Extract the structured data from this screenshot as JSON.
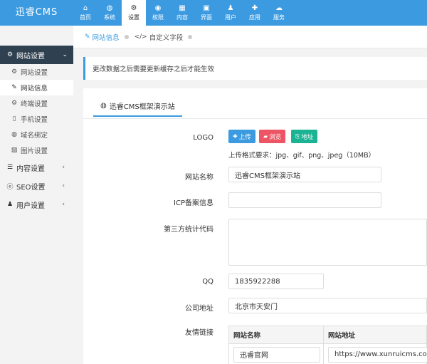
{
  "app": {
    "logo": "迅睿CMS"
  },
  "nav": [
    {
      "label": "首页",
      "icon": "home-icon",
      "glyph": "⌂",
      "active": false
    },
    {
      "label": "系统",
      "icon": "globe-icon",
      "glyph": "◍",
      "active": false
    },
    {
      "label": "设置",
      "icon": "cogs-icon",
      "glyph": "⚙",
      "active": true
    },
    {
      "label": "权限",
      "icon": "user-circle-icon",
      "glyph": "◉",
      "active": false
    },
    {
      "label": "内容",
      "icon": "grid-icon",
      "glyph": "▦",
      "active": false
    },
    {
      "label": "界面",
      "icon": "html5-icon",
      "glyph": "▣",
      "active": false
    },
    {
      "label": "用户",
      "icon": "user-icon",
      "glyph": "♟",
      "active": false
    },
    {
      "label": "应用",
      "icon": "puzzle-icon",
      "glyph": "✚",
      "active": false
    },
    {
      "label": "服务",
      "icon": "cloud-icon",
      "glyph": "☁",
      "active": false
    }
  ],
  "sidebar": {
    "active_group": {
      "label": "网站设置",
      "icon": "gear-icon",
      "glyph": "⚙"
    },
    "sub_items": [
      {
        "label": "网站设置",
        "icon": "gear-icon",
        "glyph": "⚙",
        "active": false
      },
      {
        "label": "网站信息",
        "icon": "edit-icon",
        "glyph": "✎",
        "active": true
      },
      {
        "label": "终端设置",
        "icon": "cogs-icon",
        "glyph": "⚙",
        "active": false
      },
      {
        "label": "手机设置",
        "icon": "mobile-icon",
        "glyph": "▯",
        "active": false
      },
      {
        "label": "域名绑定",
        "icon": "globe-icon",
        "glyph": "◍",
        "active": false
      },
      {
        "label": "图片设置",
        "icon": "image-icon",
        "glyph": "▨",
        "active": false
      }
    ],
    "groups": [
      {
        "label": "内容设置",
        "icon": "bars-icon",
        "glyph": "☰"
      },
      {
        "label": "SEO设置",
        "icon": "ie-icon",
        "glyph": "ⓔ"
      },
      {
        "label": "用户设置",
        "icon": "user-icon",
        "glyph": "♟"
      }
    ]
  },
  "tabs": [
    {
      "label": "网站信息",
      "icon": "edit-icon",
      "glyph": "✎",
      "active": true
    },
    {
      "label": "自定义字段",
      "icon": "code-icon",
      "glyph": "</>",
      "active": false
    }
  ],
  "notice": "更改数据之后需要更新缓存之后才能生效",
  "panel": {
    "tab_label": "迅睿CMS框架演示站",
    "tab_icon": "globe-icon",
    "tab_glyph": "◍"
  },
  "form": {
    "logo_label": "LOGO",
    "upload_label": "上传",
    "browse_label": "浏览",
    "address_label": "地址",
    "upload_hint": "上传格式要求：jpg、gif、png、jpeg（10MB）",
    "site_name_label": "网站名称",
    "site_name_value": "迅睿CMS框架演示站",
    "icp_label": "ICP备案信息",
    "icp_value": "",
    "stats_label": "第三方统计代码",
    "stats_value": "",
    "qq_label": "QQ",
    "qq_value": "1835922288",
    "address_field_label": "公司地址",
    "address_value": "北京市天安门",
    "links_label": "友情链接",
    "links_headers": [
      "网站名称",
      "网站地址"
    ],
    "links_rows": [
      {
        "name": "迅睿官网",
        "url": "https://www.xunruicms.com"
      }
    ]
  },
  "colors": {
    "primary": "#3c9be0",
    "danger": "#ed5565",
    "success": "#1ab394",
    "sidebar_dark": "#2f4050"
  }
}
